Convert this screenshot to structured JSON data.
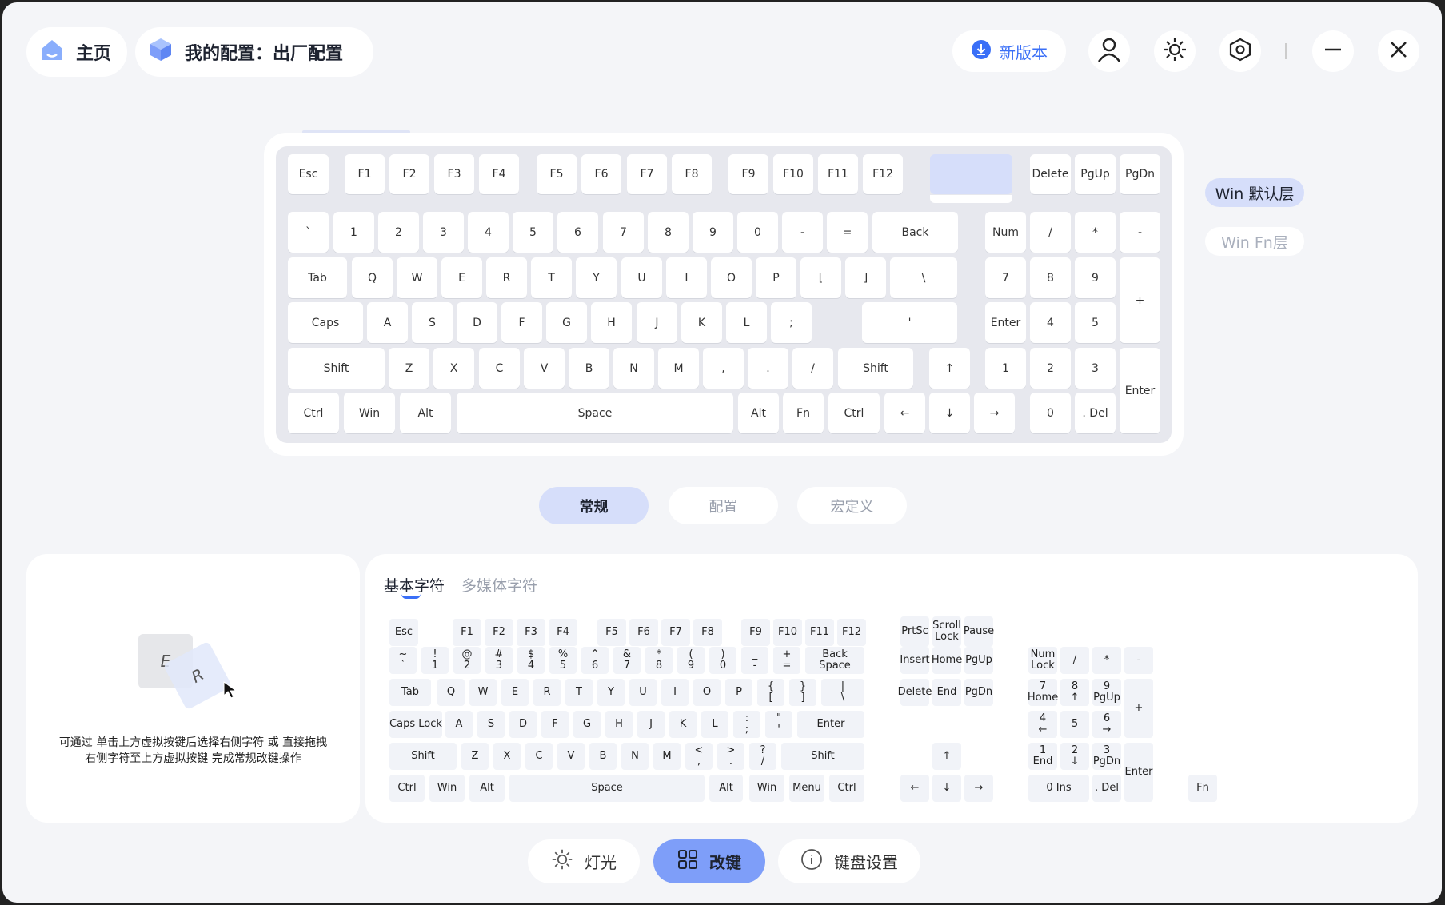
{
  "header": {
    "home_label": "主页",
    "config_label": "我的配置：出厂配置",
    "new_version_label": "新版本",
    "icons": [
      "download-icon",
      "user-icon",
      "brightness-icon",
      "settings-icon",
      "minimize-icon",
      "close-icon"
    ]
  },
  "layers": {
    "default": "Win 默认层",
    "fn": "Win Fn层"
  },
  "keyboard": {
    "rows": [
      [
        "Esc",
        "F1",
        "F2",
        "F3",
        "F4",
        "F5",
        "F6",
        "F7",
        "F8",
        "F9",
        "F10",
        "F11",
        "F12",
        "",
        "Delete",
        "PgUp",
        "PgDn"
      ],
      [
        "`",
        "1",
        "2",
        "3",
        "4",
        "5",
        "6",
        "7",
        "8",
        "9",
        "0",
        "-",
        "=",
        "Back",
        "Num",
        "/",
        "*",
        "-"
      ],
      [
        "Tab",
        "Q",
        "W",
        "E",
        "R",
        "T",
        "Y",
        "U",
        "I",
        "O",
        "P",
        "[",
        "]",
        "\\",
        "7",
        "8",
        "9",
        "+"
      ],
      [
        "Caps",
        "A",
        "S",
        "D",
        "F",
        "G",
        "H",
        "J",
        "K",
        "L",
        ";",
        "'",
        "Enter",
        "4",
        "5",
        "6"
      ],
      [
        "Shift",
        "Z",
        "X",
        "C",
        "V",
        "B",
        "N",
        "M",
        ",",
        ".",
        "/",
        "Shift",
        "↑",
        "1",
        "2",
        "3",
        "Enter"
      ],
      [
        "Ctrl",
        "Win",
        "Alt",
        "Space",
        "Alt",
        "Fn",
        "Ctrl",
        "←",
        "↓",
        "→",
        "0",
        ". Del"
      ]
    ]
  },
  "mode_tabs": [
    "常规",
    "配置",
    "宏定义"
  ],
  "left_panel": {
    "key1": "E",
    "key2": "R",
    "hint_line1": "可通过 单击上方虚拟按键后选择右侧字符 或 直接拖拽",
    "hint_line2": "右侧字符至上方虚拟按键 完成常规改键操作"
  },
  "char_tabs": {
    "basic": "基本字符",
    "media": "多媒体字符"
  },
  "charset": {
    "r0": [
      "Esc",
      "F1",
      "F2",
      "F3",
      "F4",
      "F5",
      "F6",
      "F7",
      "F8",
      "F9",
      "F10",
      "F11",
      "F12"
    ],
    "r1": [
      [
        "~",
        "`"
      ],
      [
        "!",
        "1"
      ],
      [
        "@",
        "2"
      ],
      [
        "#",
        "3"
      ],
      [
        "$",
        "4"
      ],
      [
        "%",
        "5"
      ],
      [
        "^",
        "6"
      ],
      [
        "&",
        "7"
      ],
      [
        "*",
        "8"
      ],
      [
        "(",
        "9"
      ],
      [
        ")",
        "0"
      ],
      [
        "_",
        "-"
      ],
      [
        "+",
        "="
      ],
      [
        "Back Space"
      ]
    ],
    "r2": [
      [
        "Tab"
      ],
      [
        "Q"
      ],
      [
        "W"
      ],
      [
        "E"
      ],
      [
        "R"
      ],
      [
        "T"
      ],
      [
        "Y"
      ],
      [
        "U"
      ],
      [
        "I"
      ],
      [
        "O"
      ],
      [
        "P"
      ],
      [
        "{",
        "["
      ],
      [
        "}",
        "]"
      ],
      [
        "|",
        "\\"
      ]
    ],
    "r3": [
      [
        "Caps Lock"
      ],
      [
        "A"
      ],
      [
        "S"
      ],
      [
        "D"
      ],
      [
        "F"
      ],
      [
        "G"
      ],
      [
        "H"
      ],
      [
        "J"
      ],
      [
        "K"
      ],
      [
        "L"
      ],
      [
        ":",
        ";"
      ],
      [
        "\"",
        "'"
      ],
      [
        "Enter"
      ]
    ],
    "r4": [
      [
        "Shift"
      ],
      [
        "Z"
      ],
      [
        "X"
      ],
      [
        "C"
      ],
      [
        "V"
      ],
      [
        "B"
      ],
      [
        "N"
      ],
      [
        "M"
      ],
      [
        "<",
        ","
      ],
      [
        ">",
        "."
      ],
      [
        "?",
        "/"
      ],
      [
        "Shift"
      ]
    ],
    "r5": [
      "Ctrl",
      "Win",
      "Alt",
      "Space",
      "Alt",
      "Win",
      "Menu",
      "Ctrl"
    ],
    "nav": {
      "top": [
        [
          "PrtSc"
        ],
        [
          "Scroll",
          "Lock"
        ],
        [
          "Pause"
        ]
      ],
      "mid1": [
        "Insert",
        "Home",
        "PgUp"
      ],
      "mid2": [
        "Delete",
        "End",
        "PgDn"
      ],
      "up": "↑",
      "bottom": [
        "←",
        "↓",
        "→"
      ]
    },
    "numpad": {
      "r1": [
        [
          "Num",
          "Lock"
        ],
        [
          "/"
        ],
        [
          "*"
        ],
        [
          "-"
        ]
      ],
      "r2": [
        [
          "7",
          "Home"
        ],
        [
          "8",
          "↑"
        ],
        [
          "9",
          "PgUp"
        ]
      ],
      "r3": [
        [
          "4",
          "←"
        ],
        [
          "5"
        ],
        [
          "6",
          "→"
        ]
      ],
      "r4": [
        [
          "1",
          "End"
        ],
        [
          "2",
          "↓"
        ],
        [
          "3",
          "PgDn"
        ]
      ],
      "r5": [
        [
          "0 Ins"
        ],
        [
          ". Del"
        ]
      ],
      "plus": "+",
      "enter": "Enter"
    },
    "fn": "Fn"
  },
  "footer": {
    "lighting": "灯光",
    "remap": "改键",
    "settings": "键盘设置"
  },
  "colors": {
    "accent": "#3a6ff7",
    "active_tab": "#d6defa",
    "active_footer": "#7e9ef9",
    "background": "#f4f5f8"
  }
}
